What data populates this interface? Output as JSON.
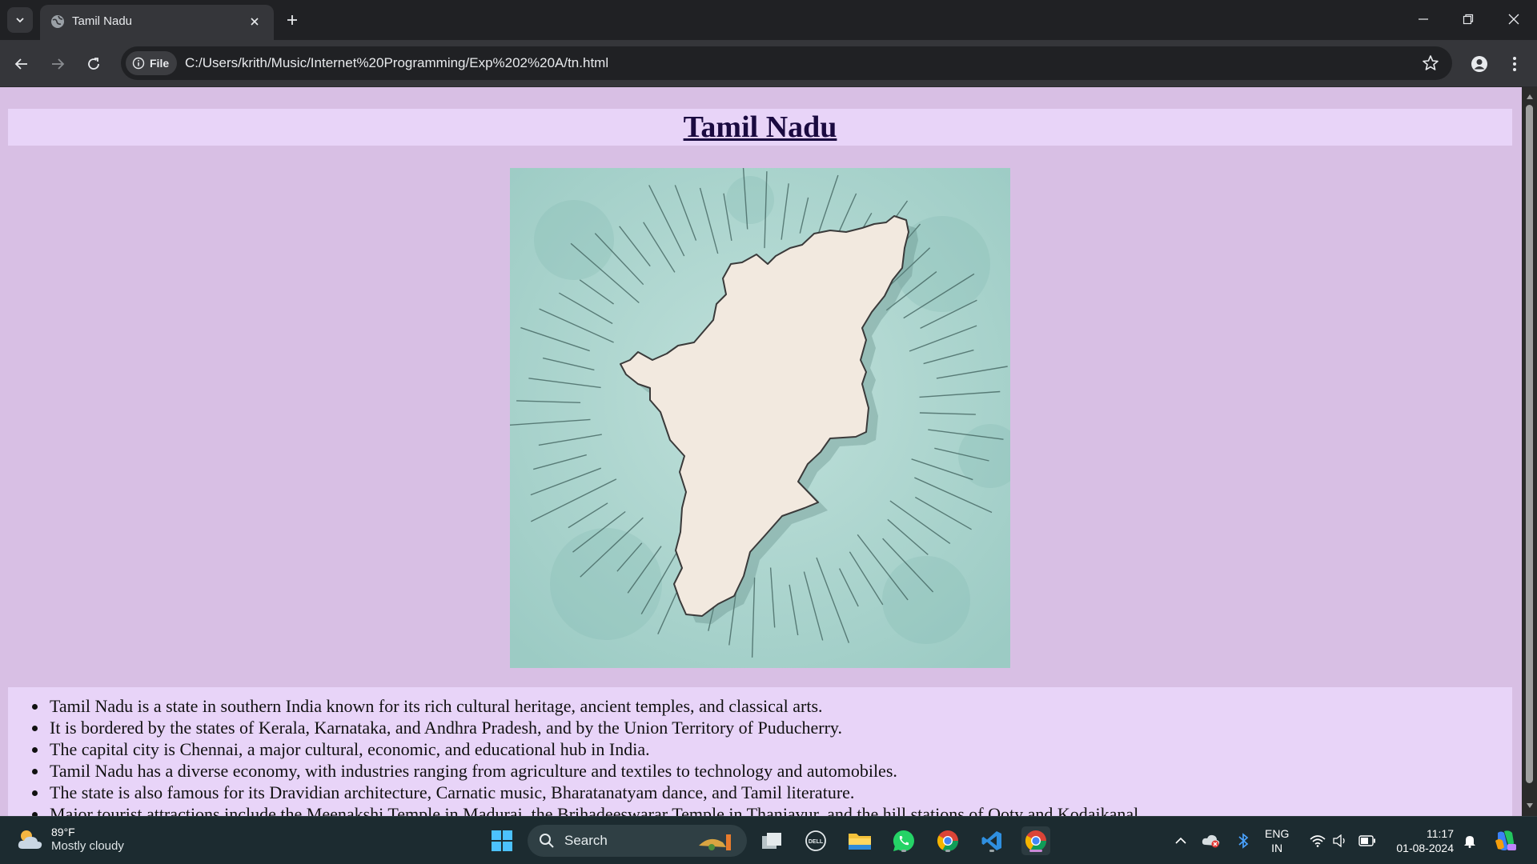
{
  "browser": {
    "tab_title": "Tamil Nadu",
    "file_chip": "File",
    "url": "C:/Users/krith/Music/Internet%20Programming/Exp%202%20A/tn.html"
  },
  "page": {
    "heading": "Tamil Nadu",
    "map_image": "tamil-nadu-map",
    "facts": [
      "Tamil Nadu is a state in southern India known for its rich cultural heritage, ancient temples, and classical arts.",
      "It is bordered by the states of Kerala, Karnataka, and Andhra Pradesh, and by the Union Territory of Puducherry.",
      "The capital city is Chennai, a major cultural, economic, and educational hub in India.",
      "Tamil Nadu has a diverse economy, with industries ranging from agriculture and textiles to technology and automobiles.",
      "The state is also famous for its Dravidian architecture, Carnatic music, Bharatanatyam dance, and Tamil literature.",
      "Major tourist attractions include the Meenakshi Temple in Madurai, the Brihadeeswarar Temple in Thanjavur, and the hill stations of Ooty and Kodaikanal."
    ]
  },
  "taskbar": {
    "weather_temp": "89°F",
    "weather_condition": "Mostly cloudy",
    "search_label": "Search",
    "language_line1": "ENG",
    "language_line2": "IN",
    "time": "11:17",
    "date": "01-08-2024",
    "pinned": [
      "start-icon",
      "search",
      "task-view-icon",
      "dell-icon",
      "file-explorer-icon",
      "whatsapp-icon",
      "chrome-icon",
      "vscode-icon",
      "chrome-profile-icon"
    ]
  },
  "colors": {
    "page_background": "#d8bfe4",
    "heading_band": "#e8d4f8",
    "heading_text": "#1a0a40",
    "map_background": "#a9d3cc",
    "map_land": "#f2e9df"
  }
}
